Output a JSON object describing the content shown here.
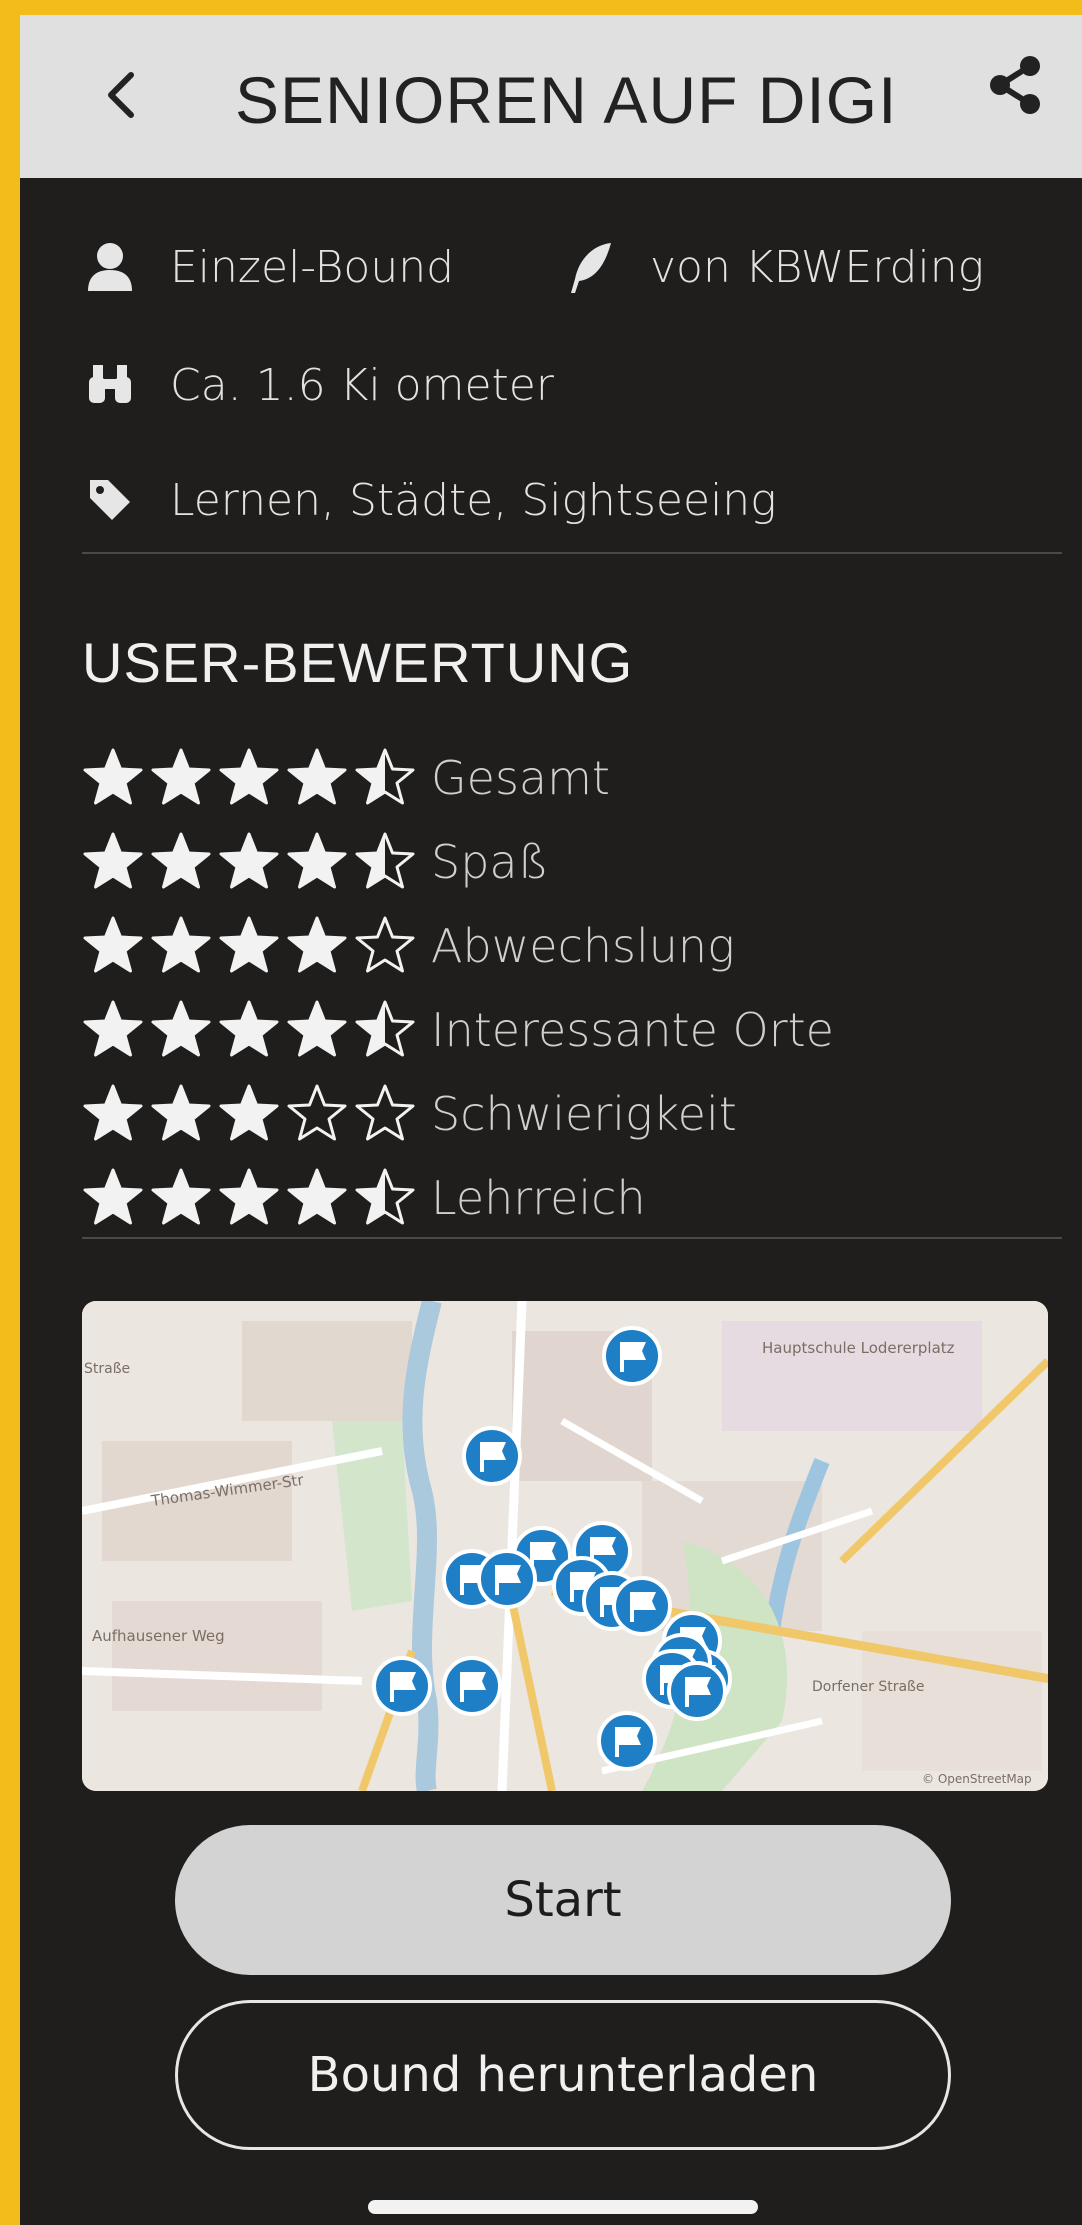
{
  "colors": {
    "frame": "#f2bc1b",
    "background": "#1f1e1d",
    "header": "#e0e0e0",
    "accent_marker": "#1e7fc6",
    "star": "#f2f2f2"
  },
  "header": {
    "back_icon": "chevron-left-icon",
    "title": "SENIOREN AUF DIGI",
    "share_icon": "share-icon"
  },
  "info": {
    "type_label": "Einzel-Bound",
    "author_label": "von KBWErding",
    "distance_label": "Ca. 1.6 Ki ometer",
    "tags_label": "Lernen, Städte, Sightseeing"
  },
  "ratings": {
    "title": "USER-BEWERTUNG",
    "items": [
      {
        "label": "Gesamt",
        "stars": 4.5
      },
      {
        "label": "Spaß",
        "stars": 4.5
      },
      {
        "label": "Abwechslung",
        "stars": 4
      },
      {
        "label": "Interessante Orte",
        "stars": 4.5
      },
      {
        "label": "Schwierigkeit",
        "stars": 3
      },
      {
        "label": "Lehrreich",
        "stars": 4.5
      }
    ]
  },
  "map": {
    "labels": {
      "school": "Hauptschule Lodererplatz",
      "street_thomas": "Thomas-Wimmer-Str",
      "street_aufhausen": "Aufhausener Weg",
      "street_dorfen": "Dorfener Straße",
      "street_strasse": "Straße",
      "attribution": "© OpenStreetMap"
    }
  },
  "buttons": {
    "start": "Start",
    "download": "Bound herunterladen"
  }
}
